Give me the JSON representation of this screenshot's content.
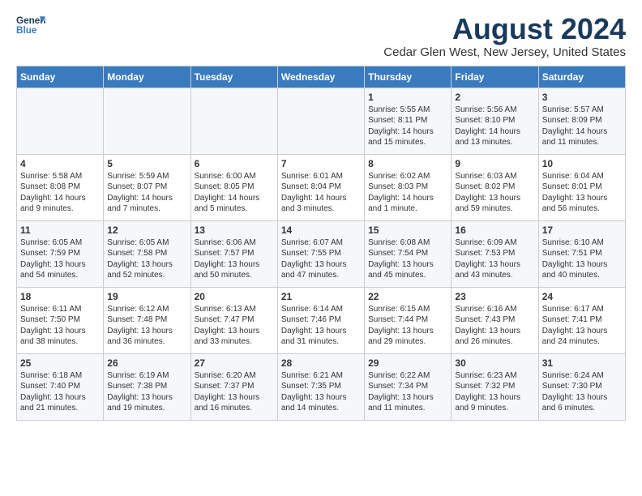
{
  "header": {
    "logo_line1": "General",
    "logo_line2": "Blue",
    "month_year": "August 2024",
    "location": "Cedar Glen West, New Jersey, United States"
  },
  "days_of_week": [
    "Sunday",
    "Monday",
    "Tuesday",
    "Wednesday",
    "Thursday",
    "Friday",
    "Saturday"
  ],
  "weeks": [
    [
      {
        "day": "",
        "info": ""
      },
      {
        "day": "",
        "info": ""
      },
      {
        "day": "",
        "info": ""
      },
      {
        "day": "",
        "info": ""
      },
      {
        "day": "1",
        "info": "Sunrise: 5:55 AM\nSunset: 8:11 PM\nDaylight: 14 hours\nand 15 minutes."
      },
      {
        "day": "2",
        "info": "Sunrise: 5:56 AM\nSunset: 8:10 PM\nDaylight: 14 hours\nand 13 minutes."
      },
      {
        "day": "3",
        "info": "Sunrise: 5:57 AM\nSunset: 8:09 PM\nDaylight: 14 hours\nand 11 minutes."
      }
    ],
    [
      {
        "day": "4",
        "info": "Sunrise: 5:58 AM\nSunset: 8:08 PM\nDaylight: 14 hours\nand 9 minutes."
      },
      {
        "day": "5",
        "info": "Sunrise: 5:59 AM\nSunset: 8:07 PM\nDaylight: 14 hours\nand 7 minutes."
      },
      {
        "day": "6",
        "info": "Sunrise: 6:00 AM\nSunset: 8:05 PM\nDaylight: 14 hours\nand 5 minutes."
      },
      {
        "day": "7",
        "info": "Sunrise: 6:01 AM\nSunset: 8:04 PM\nDaylight: 14 hours\nand 3 minutes."
      },
      {
        "day": "8",
        "info": "Sunrise: 6:02 AM\nSunset: 8:03 PM\nDaylight: 14 hours\nand 1 minute."
      },
      {
        "day": "9",
        "info": "Sunrise: 6:03 AM\nSunset: 8:02 PM\nDaylight: 13 hours\nand 59 minutes."
      },
      {
        "day": "10",
        "info": "Sunrise: 6:04 AM\nSunset: 8:01 PM\nDaylight: 13 hours\nand 56 minutes."
      }
    ],
    [
      {
        "day": "11",
        "info": "Sunrise: 6:05 AM\nSunset: 7:59 PM\nDaylight: 13 hours\nand 54 minutes."
      },
      {
        "day": "12",
        "info": "Sunrise: 6:05 AM\nSunset: 7:58 PM\nDaylight: 13 hours\nand 52 minutes."
      },
      {
        "day": "13",
        "info": "Sunrise: 6:06 AM\nSunset: 7:57 PM\nDaylight: 13 hours\nand 50 minutes."
      },
      {
        "day": "14",
        "info": "Sunrise: 6:07 AM\nSunset: 7:55 PM\nDaylight: 13 hours\nand 47 minutes."
      },
      {
        "day": "15",
        "info": "Sunrise: 6:08 AM\nSunset: 7:54 PM\nDaylight: 13 hours\nand 45 minutes."
      },
      {
        "day": "16",
        "info": "Sunrise: 6:09 AM\nSunset: 7:53 PM\nDaylight: 13 hours\nand 43 minutes."
      },
      {
        "day": "17",
        "info": "Sunrise: 6:10 AM\nSunset: 7:51 PM\nDaylight: 13 hours\nand 40 minutes."
      }
    ],
    [
      {
        "day": "18",
        "info": "Sunrise: 6:11 AM\nSunset: 7:50 PM\nDaylight: 13 hours\nand 38 minutes."
      },
      {
        "day": "19",
        "info": "Sunrise: 6:12 AM\nSunset: 7:48 PM\nDaylight: 13 hours\nand 36 minutes."
      },
      {
        "day": "20",
        "info": "Sunrise: 6:13 AM\nSunset: 7:47 PM\nDaylight: 13 hours\nand 33 minutes."
      },
      {
        "day": "21",
        "info": "Sunrise: 6:14 AM\nSunset: 7:46 PM\nDaylight: 13 hours\nand 31 minutes."
      },
      {
        "day": "22",
        "info": "Sunrise: 6:15 AM\nSunset: 7:44 PM\nDaylight: 13 hours\nand 29 minutes."
      },
      {
        "day": "23",
        "info": "Sunrise: 6:16 AM\nSunset: 7:43 PM\nDaylight: 13 hours\nand 26 minutes."
      },
      {
        "day": "24",
        "info": "Sunrise: 6:17 AM\nSunset: 7:41 PM\nDaylight: 13 hours\nand 24 minutes."
      }
    ],
    [
      {
        "day": "25",
        "info": "Sunrise: 6:18 AM\nSunset: 7:40 PM\nDaylight: 13 hours\nand 21 minutes."
      },
      {
        "day": "26",
        "info": "Sunrise: 6:19 AM\nSunset: 7:38 PM\nDaylight: 13 hours\nand 19 minutes."
      },
      {
        "day": "27",
        "info": "Sunrise: 6:20 AM\nSunset: 7:37 PM\nDaylight: 13 hours\nand 16 minutes."
      },
      {
        "day": "28",
        "info": "Sunrise: 6:21 AM\nSunset: 7:35 PM\nDaylight: 13 hours\nand 14 minutes."
      },
      {
        "day": "29",
        "info": "Sunrise: 6:22 AM\nSunset: 7:34 PM\nDaylight: 13 hours\nand 11 minutes."
      },
      {
        "day": "30",
        "info": "Sunrise: 6:23 AM\nSunset: 7:32 PM\nDaylight: 13 hours\nand 9 minutes."
      },
      {
        "day": "31",
        "info": "Sunrise: 6:24 AM\nSunset: 7:30 PM\nDaylight: 13 hours\nand 6 minutes."
      }
    ]
  ]
}
